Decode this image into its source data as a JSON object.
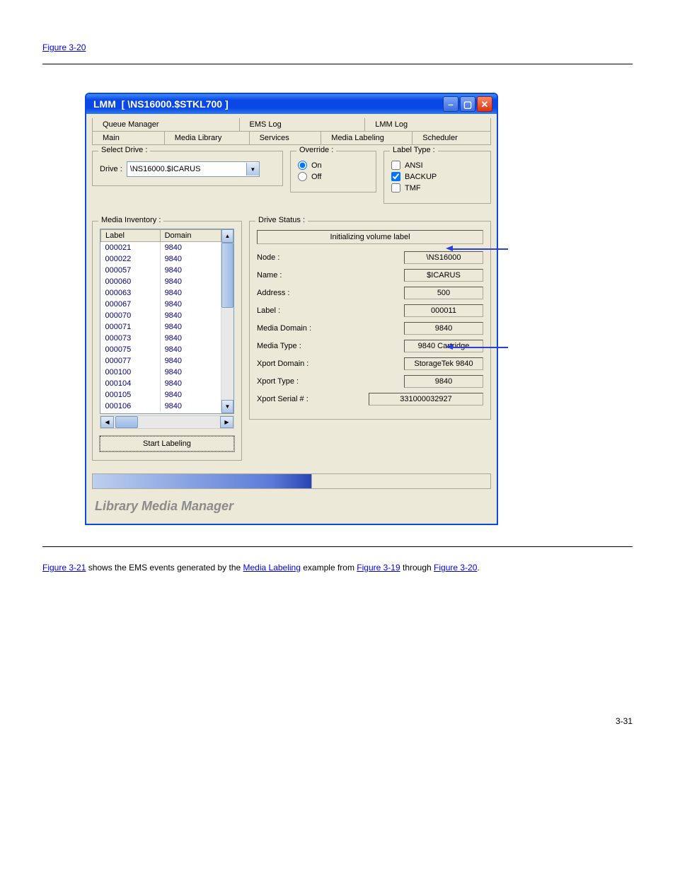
{
  "top_link": "Figure 3-20",
  "window": {
    "title_prefix": "LMM",
    "title_suffix": "[ \\NS16000.$STKL700 ]"
  },
  "tabs_row1": [
    "Queue Manager",
    "EMS Log",
    "LMM Log"
  ],
  "tabs_row2": [
    "Main",
    "Media Library",
    "Services",
    "Media Labeling",
    "Scheduler"
  ],
  "select_drive": {
    "group": "Select Drive :",
    "label": "Drive :",
    "value": "\\NS16000.$ICARUS"
  },
  "override": {
    "group": "Override :",
    "on": "On",
    "off": "Off",
    "selected": "on"
  },
  "label_type": {
    "group": "Label Type :",
    "ansi": "ANSI",
    "backup": "BACKUP",
    "tmf": "TMF"
  },
  "media_inventory": {
    "group": "Media Inventory :",
    "headers": [
      "Label",
      "Domain"
    ],
    "rows": [
      [
        "000021",
        "9840"
      ],
      [
        "000022",
        "9840"
      ],
      [
        "000057",
        "9840"
      ],
      [
        "000060",
        "9840"
      ],
      [
        "000063",
        "9840"
      ],
      [
        "000067",
        "9840"
      ],
      [
        "000070",
        "9840"
      ],
      [
        "000071",
        "9840"
      ],
      [
        "000073",
        "9840"
      ],
      [
        "000075",
        "9840"
      ],
      [
        "000077",
        "9840"
      ],
      [
        "000100",
        "9840"
      ],
      [
        "000104",
        "9840"
      ],
      [
        "000105",
        "9840"
      ],
      [
        "000106",
        "9840"
      ]
    ],
    "start_button": "Start Labeling"
  },
  "drive_status": {
    "group": "Drive Status :",
    "message": "Initializing volume label",
    "fields": [
      {
        "k": "Node :",
        "v": "\\NS16000"
      },
      {
        "k": "Name :",
        "v": "$ICARUS"
      },
      {
        "k": "Address :",
        "v": "500"
      },
      {
        "k": "Label :",
        "v": "000011"
      },
      {
        "k": "Media Domain :",
        "v": "9840"
      },
      {
        "k": "Media Type :",
        "v": "9840 Cartridge"
      },
      {
        "k": "Xport Domain :",
        "v": "StorageTek 9840"
      },
      {
        "k": "Xport Type :",
        "v": "9840"
      }
    ],
    "serial_label": "Xport Serial # :",
    "serial_value": "331000032927"
  },
  "footer_text": "Library Media Manager",
  "below": {
    "p1a": "Figure 3-21",
    "p1b": " shows the EMS events generated by the ",
    "p1c": "Media Labeling",
    "p1d": " example from ",
    "p2a": "Figure 3-19",
    "p2b": " through ",
    "p2c": "Figure 3-20",
    "p2d": "."
  },
  "page_number": "3-31"
}
